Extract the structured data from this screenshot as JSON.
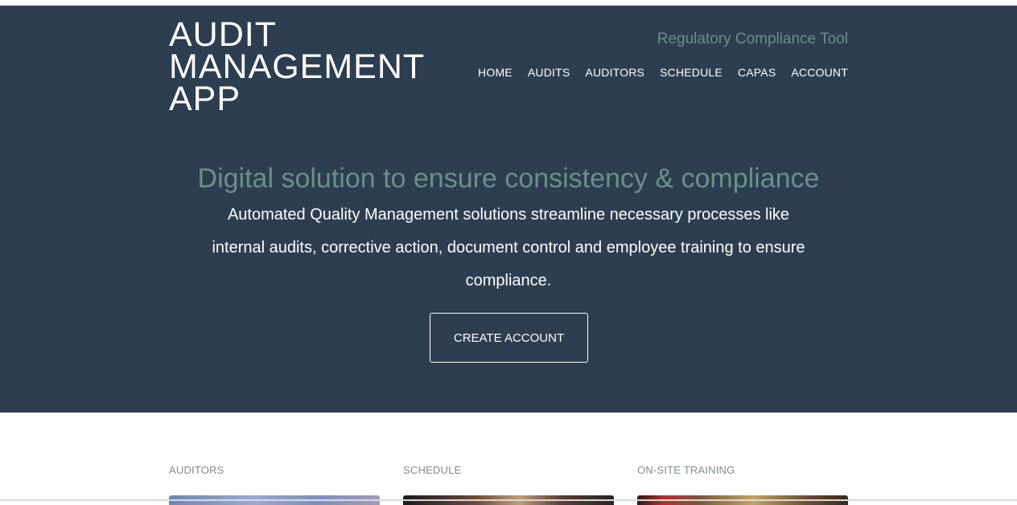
{
  "brand": {
    "line1": "AUDIT",
    "line2": "MANAGEMENT",
    "line3": "APP"
  },
  "tagline": "Regulatory Compliance Tool",
  "nav": {
    "items": [
      {
        "label": "HOME"
      },
      {
        "label": "AUDITS"
      },
      {
        "label": "AUDITORS"
      },
      {
        "label": "SCHEDULE"
      },
      {
        "label": "CAPAS"
      },
      {
        "label": "ACCOUNT"
      }
    ]
  },
  "hero": {
    "headline": "Digital solution to ensure consistency & compliance",
    "lead": "Automated Quality Management solutions streamline necessary processes like internal audits, corrective action, document control and employee training to ensure compliance.",
    "cta_label": "CREATE ACCOUNT"
  },
  "cards": [
    {
      "title": "AUDITORS"
    },
    {
      "title": "SCHEDULE"
    },
    {
      "title": "ON-SITE TRAINING"
    }
  ],
  "colors": {
    "hero_bg": "#2d3e50",
    "accent_teal": "#6b8f8a",
    "muted_gray": "#7f8c8d"
  }
}
